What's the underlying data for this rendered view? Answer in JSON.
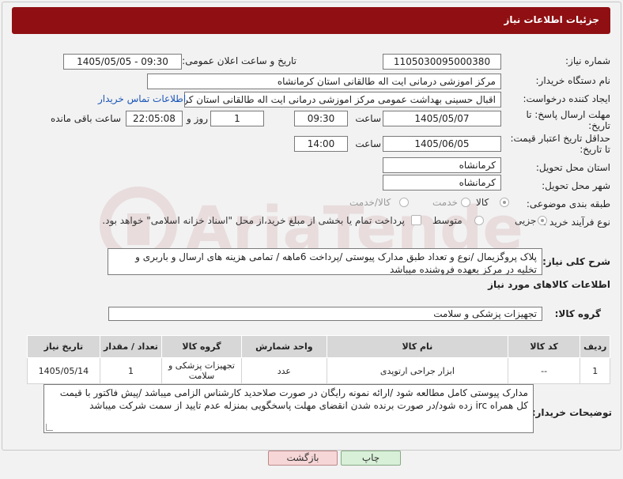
{
  "header": {
    "title": "جزئیات اطلاعات نیاز"
  },
  "form": {
    "need_number": {
      "label": "شماره نیاز:",
      "value": "1105030095000380"
    },
    "announce_datetime": {
      "label": "تاریخ و ساعت اعلان عمومی:",
      "value": "1405/05/05 - 09:30"
    },
    "buyer_org": {
      "label": "نام دستگاه خریدار:",
      "value": "مرکز اموزشی درمانی ایت اله طالقانی استان کرمانشاه"
    },
    "requester": {
      "label": "ایجاد کننده درخواست:",
      "value": "اقبال حسینی بهداشت عمومی مرکز اموزشی درمانی ایت اله طالقانی استان کرمانشاه",
      "contact_link": "اطلاعات تماس خریدار"
    },
    "reply_deadline": {
      "label_line1": "مهلت ارسال پاسخ: تا",
      "label_line2": "تاریخ:",
      "date": "1405/05/07",
      "time_label": "ساعت",
      "time": "09:30",
      "days": "1",
      "days_label": "روز و",
      "remaining": "22:05:08",
      "remaining_label": "ساعت باقی مانده"
    },
    "price_validity": {
      "label_line1": "حداقل تاریخ اعتبار قیمت:",
      "label_line2": "تا تاریخ:",
      "date": "1405/06/05",
      "time_label": "ساعت",
      "time": "14:00"
    },
    "delivery_province": {
      "label": "استان محل تحویل:",
      "value": "کرمانشاه"
    },
    "delivery_city": {
      "label": "شهر محل تحویل:",
      "value": "کرمانشاه"
    },
    "category": {
      "label": "طبقه بندی موضوعی:",
      "options": [
        "کالا",
        "خدمت",
        "کالا/خدمت"
      ],
      "selected": "کالا"
    },
    "purchase_process": {
      "label": "نوع فرآیند خرید :",
      "options": [
        "جزیی",
        "متوسط"
      ],
      "selected": "جزیی",
      "payment_text": "پرداخت تمام یا بخشی از مبلغ خرید،از محل \"اسناد خزانه اسلامی\" خواهد بود."
    }
  },
  "description": {
    "label": "شرح کلی نیاز:",
    "text": "پلاک پروگزیمال /نوع و تعداد طبق مدارک پیوستی /پرداخت 6ماهه / تمامی هزینه های ارسال و باربری و تخلیه در مرکز بعهده فروشنده میباشد"
  },
  "goods": {
    "section_title": "اطلاعات کالاهای مورد نیاز",
    "group_label": "گروه کالا:",
    "group_value": "تجهیزات پزشکی و سلامت",
    "columns": [
      "ردیف",
      "کد کالا",
      "نام کالا",
      "واحد شمارش",
      "گروه کالا",
      "تعداد / مقدار",
      "تاریخ نیاز"
    ],
    "rows": [
      {
        "row": "1",
        "code": "--",
        "name": "ابزار جراحی ارتوپدی",
        "unit": "عدد",
        "group": "تجهیزات پزشکی و سلامت",
        "qty": "1",
        "date": "1405/05/14"
      }
    ]
  },
  "buyer_notes": {
    "label": "توضیحات خریدار:",
    "text": "مدارک پیوستی کامل مطالعه شود /ارائه نمونه رایگان در صورت صلاحدید کارشناس الزامی میباشد /پیش فاکتور با قیمت کل همراه irc زده شود/در صورت برنده شدن انقضای مهلت پاسخگویی بمنزله عدم تایید از سمت شرکت میباشد"
  },
  "buttons": {
    "print": "چاپ",
    "back": "بازگشت"
  },
  "colors": {
    "header": "#8f0f12",
    "link": "#1a56b8"
  }
}
